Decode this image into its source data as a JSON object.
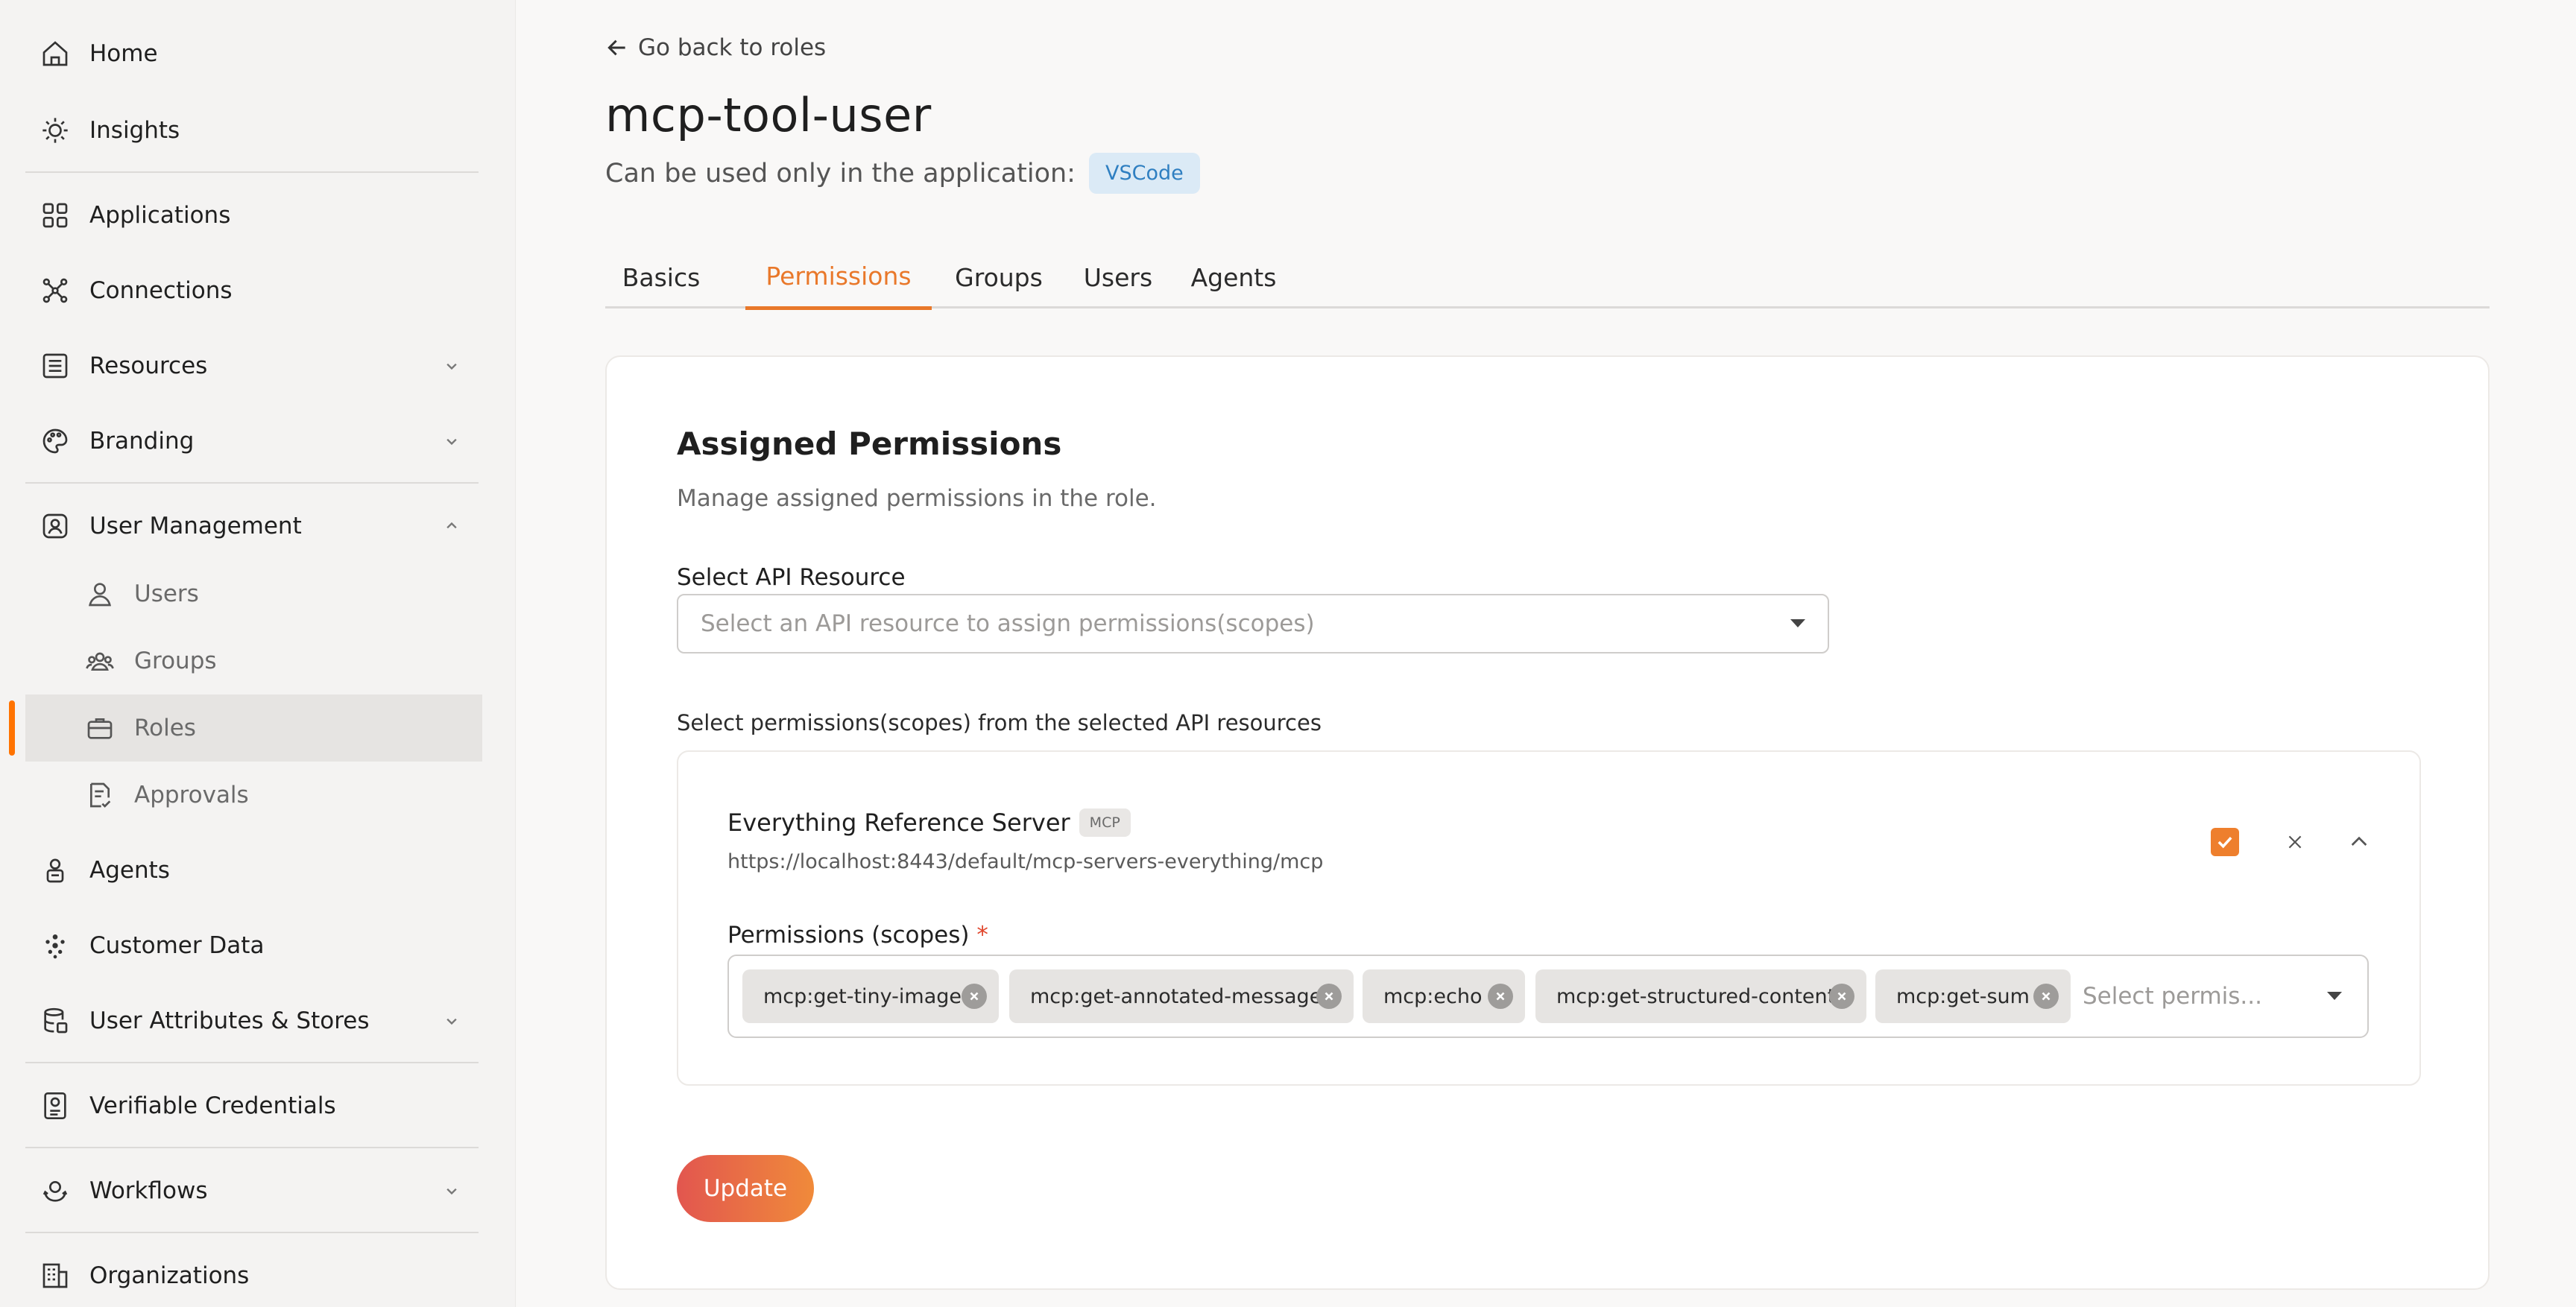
{
  "sidebar": {
    "items": [
      {
        "label": "Home",
        "icon": "home-icon"
      },
      {
        "label": "Insights",
        "icon": "lightbulb-icon"
      },
      {
        "label": "Applications",
        "icon": "grid-icon"
      },
      {
        "label": "Connections",
        "icon": "connections-icon"
      },
      {
        "label": "Resources",
        "icon": "list-icon"
      },
      {
        "label": "Branding",
        "icon": "palette-icon"
      },
      {
        "label": "User Management",
        "icon": "user-badge-icon"
      },
      {
        "label": "Users",
        "icon": "user-icon"
      },
      {
        "label": "Groups",
        "icon": "group-icon"
      },
      {
        "label": "Roles",
        "icon": "briefcase-icon"
      },
      {
        "label": "Approvals",
        "icon": "approval-icon"
      },
      {
        "label": "Agents",
        "icon": "agent-icon"
      },
      {
        "label": "Customer Data",
        "icon": "customer-data-icon"
      },
      {
        "label": "User Attributes & Stores",
        "icon": "database-icon"
      },
      {
        "label": "Verifiable Credentials",
        "icon": "credential-icon"
      },
      {
        "label": "Workflows",
        "icon": "workflow-icon"
      },
      {
        "label": "Organizations",
        "icon": "building-icon"
      }
    ],
    "active_item": "Roles",
    "accent_color": "#ff7300"
  },
  "header": {
    "back_link": "Go back to roles",
    "title": "mcp-tool-user",
    "subtitle": "Can be used only in the application:",
    "app_badge": "VSCode"
  },
  "tabs": [
    {
      "label": "Basics"
    },
    {
      "label": "Permissions",
      "active": true
    },
    {
      "label": "Groups"
    },
    {
      "label": "Users"
    },
    {
      "label": "Agents"
    }
  ],
  "permissions": {
    "title": "Assigned Permissions",
    "description": "Manage assigned permissions in the role.",
    "api_resource_label": "Select API Resource",
    "api_resource_placeholder": "Select an API resource to assign permissions(scopes)",
    "scopes_section_label": "Select permissions(scopes) from the selected API resources",
    "resource": {
      "name": "Everything Reference Server",
      "tag": "MCP",
      "url": "https://localhost:8443/default/mcp-servers-everything/mcp",
      "selected": true,
      "permissions_label": "Permissions (scopes)",
      "required_mark": "*",
      "scopes": [
        "mcp:get-tiny-image",
        "mcp:get-annotated-message",
        "mcp:echo",
        "mcp:get-structured-content",
        "mcp:get-sum"
      ],
      "scopes_placeholder": "Select permis..."
    },
    "update_button": "Update"
  }
}
